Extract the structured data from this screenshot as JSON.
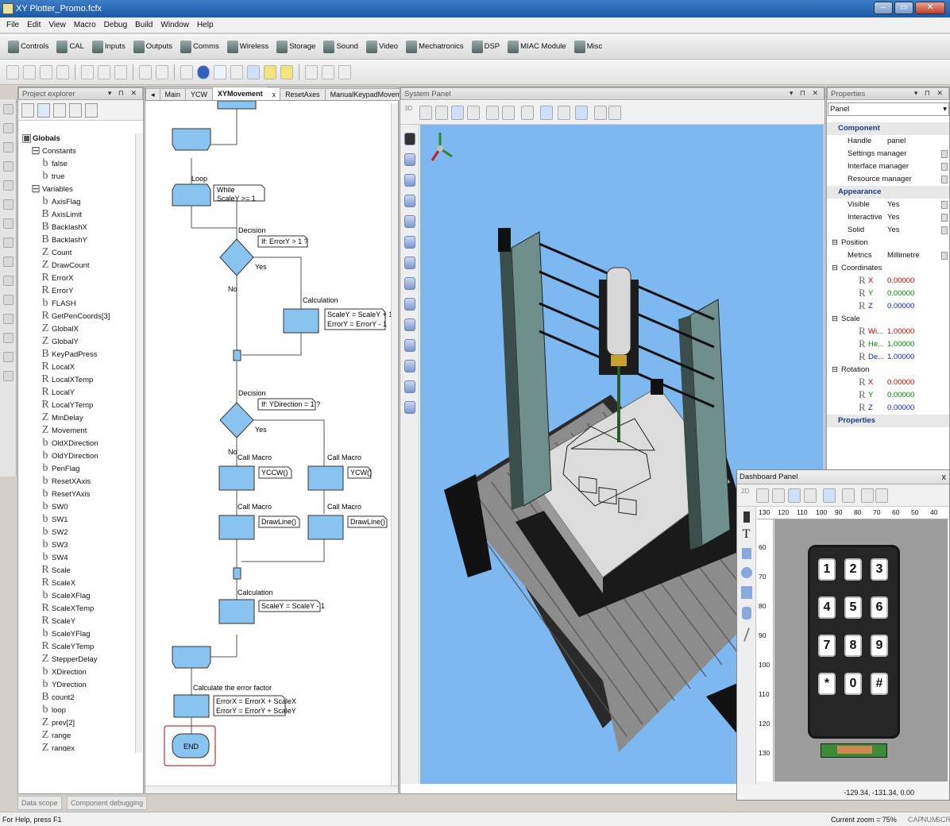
{
  "window": {
    "title": "XY Plotter_Promo.fcfx"
  },
  "menu": [
    "File",
    "Edit",
    "View",
    "Macro",
    "Debug",
    "Build",
    "Window",
    "Help"
  ],
  "component_toolbar": [
    {
      "label": "Controls",
      "icon": "controls-icon"
    },
    {
      "label": "CAL",
      "icon": "chip-icon"
    },
    {
      "label": "Inputs",
      "icon": "inputs-icon"
    },
    {
      "label": "Outputs",
      "icon": "outputs-icon"
    },
    {
      "label": "Comms",
      "icon": "comms-icon"
    },
    {
      "label": "Wireless",
      "icon": "wireless-icon"
    },
    {
      "label": "Storage",
      "icon": "storage-icon"
    },
    {
      "label": "Sound",
      "icon": "speaker-icon"
    },
    {
      "label": "Video",
      "icon": "video-icon"
    },
    {
      "label": "Mechatronics",
      "icon": "mechatronics-icon"
    },
    {
      "label": "DSP",
      "icon": "dsp-icon"
    },
    {
      "label": "MIAC Module",
      "icon": "miac-icon"
    },
    {
      "label": "Misc",
      "icon": "misc-icon"
    }
  ],
  "project_explorer": {
    "title": "Project explorer",
    "root": "Globals",
    "constants_label": "Constants",
    "constants": [
      {
        "t": "b",
        "n": "false"
      },
      {
        "t": "b",
        "n": "true"
      }
    ],
    "variables_label": "Variables",
    "variables": [
      {
        "t": "b",
        "n": "AxisFlag"
      },
      {
        "t": "B",
        "n": "AxisLimit"
      },
      {
        "t": "B",
        "n": "BacklashX"
      },
      {
        "t": "B",
        "n": "BacklashY"
      },
      {
        "t": "Z",
        "n": "Count"
      },
      {
        "t": "Z",
        "n": "DrawCount"
      },
      {
        "t": "R",
        "n": "ErrorX"
      },
      {
        "t": "R",
        "n": "ErrorY"
      },
      {
        "t": "b",
        "n": "FLASH"
      },
      {
        "t": "R",
        "n": "GetPenCoords[3]"
      },
      {
        "t": "Z",
        "n": "GlobalX"
      },
      {
        "t": "Z",
        "n": "GlobalY"
      },
      {
        "t": "B",
        "n": "KeyPadPress"
      },
      {
        "t": "R",
        "n": "LocalX"
      },
      {
        "t": "R",
        "n": "LocalXTemp"
      },
      {
        "t": "R",
        "n": "LocalY"
      },
      {
        "t": "R",
        "n": "LocalYTemp"
      },
      {
        "t": "Z",
        "n": "MinDelay"
      },
      {
        "t": "Z",
        "n": "Movement"
      },
      {
        "t": "b",
        "n": "OldXDirection"
      },
      {
        "t": "b",
        "n": "OldYDirection"
      },
      {
        "t": "b",
        "n": "PenFlag"
      },
      {
        "t": "b",
        "n": "ResetXAxis"
      },
      {
        "t": "b",
        "n": "ResetYAxis"
      },
      {
        "t": "b",
        "n": "SW0"
      },
      {
        "t": "b",
        "n": "SW1"
      },
      {
        "t": "b",
        "n": "SW2"
      },
      {
        "t": "b",
        "n": "SW3"
      },
      {
        "t": "b",
        "n": "SW4"
      },
      {
        "t": "R",
        "n": "Scale"
      },
      {
        "t": "R",
        "n": "ScaleX"
      },
      {
        "t": "b",
        "n": "ScaleXFlag"
      },
      {
        "t": "R",
        "n": "ScaleXTemp"
      },
      {
        "t": "R",
        "n": "ScaleY"
      },
      {
        "t": "b",
        "n": "ScaleYFlag"
      },
      {
        "t": "R",
        "n": "ScaleYTemp"
      },
      {
        "t": "Z",
        "n": "StepperDelay"
      },
      {
        "t": "b",
        "n": "XDirection"
      },
      {
        "t": "b",
        "n": "YDirection"
      },
      {
        "t": "B",
        "n": "count2"
      },
      {
        "t": "b",
        "n": "loop"
      },
      {
        "t": "Z",
        "n": "prev[2]"
      },
      {
        "t": "Z",
        "n": "range"
      },
      {
        "t": "Z",
        "n": "rangex"
      }
    ],
    "bottom_tabs": [
      "Data scope",
      "Component debugging"
    ]
  },
  "flowchart": {
    "tabs": [
      "Main",
      "YCW",
      "XYMovement",
      "ResetAxes",
      "ManualKeypadMovement"
    ],
    "active_tab": "XYMovement",
    "loop_label": "Loop",
    "while_text": [
      "While",
      "ScaleY >= 1"
    ],
    "decision1_label": "Decision",
    "decision1_text": "If: ErrorY > 1 ?",
    "yes": "Yes",
    "no": "No",
    "calc1_label": "Calculation",
    "calc1_text": [
      "ScaleY = ScaleY + 1",
      "ErrorY = ErrorY - 1"
    ],
    "decision2_label": "Decision",
    "decision2_text": "If: YDirection = 1 ?",
    "callmacro_label": "Call Macro",
    "macro_ycc": "YCCW()",
    "macro_ycw": "YCW()",
    "macro_draw": "DrawLine()",
    "calc2_label": "Calculation",
    "calc2_text": "ScaleY = ScaleY - 1",
    "calc3_label": "Calculate the error factor",
    "calc3_text": [
      "ErrorX = ErrorX + ScaleX",
      "ErrorY = ErrorY + ScaleY"
    ],
    "end_label": "END"
  },
  "system_panel": {
    "title": "System Panel",
    "mode": "3D"
  },
  "properties": {
    "title": "Properties",
    "selected": "Panel",
    "rows": [
      {
        "kind": "sec",
        "name": "Component"
      },
      {
        "kind": "row",
        "name": "Handle",
        "value": "panel"
      },
      {
        "kind": "row",
        "name": "Settings manager",
        "value": "",
        "dd": true
      },
      {
        "kind": "row",
        "name": "Interface manager",
        "value": "",
        "dd": true
      },
      {
        "kind": "row",
        "name": "Resource manager",
        "value": "",
        "dd": true
      },
      {
        "kind": "sec",
        "name": "Appearance"
      },
      {
        "kind": "row",
        "name": "Visible",
        "value": "Yes",
        "dd": true
      },
      {
        "kind": "row",
        "name": "Interactive",
        "value": "Yes",
        "dd": true
      },
      {
        "kind": "row",
        "name": "Solid",
        "value": "Yes",
        "dd": true
      },
      {
        "kind": "grp",
        "name": "Position"
      },
      {
        "kind": "row",
        "name": "Metrics",
        "value": "Millimetre",
        "dd": true
      },
      {
        "kind": "grp",
        "name": "Coordinates"
      },
      {
        "kind": "axis",
        "name": "X",
        "value": "0.00000",
        "c": "#c00000"
      },
      {
        "kind": "axis",
        "name": "Y",
        "value": "0.00000",
        "c": "#008000"
      },
      {
        "kind": "axis",
        "name": "Z",
        "value": "0.00000",
        "c": "#1020c0"
      },
      {
        "kind": "grp",
        "name": "Scale"
      },
      {
        "kind": "axis",
        "name": "Wi...",
        "value": "1.00000",
        "c": "#c00000"
      },
      {
        "kind": "axis",
        "name": "He...",
        "value": "1.00000",
        "c": "#008000"
      },
      {
        "kind": "axis",
        "name": "De...",
        "value": "1.00000",
        "c": "#1020c0"
      },
      {
        "kind": "grp",
        "name": "Rotation"
      },
      {
        "kind": "axis",
        "name": "X",
        "value": "0.00000",
        "c": "#c00000"
      },
      {
        "kind": "axis",
        "name": "Y",
        "value": "0.00000",
        "c": "#008000"
      },
      {
        "kind": "axis",
        "name": "Z",
        "value": "0.00000",
        "c": "#1020c0"
      },
      {
        "kind": "sec",
        "name": "Properties"
      }
    ]
  },
  "dashboard": {
    "title": "Dashboard Panel",
    "mode": "2D",
    "ruler_h": [
      "130",
      "120",
      "110",
      "100",
      "90",
      "80",
      "70",
      "60",
      "50",
      "40"
    ],
    "ruler_v": [
      "60",
      "70",
      "80",
      "90",
      "100",
      "110",
      "120",
      "130"
    ],
    "keys": [
      "1",
      "2",
      "3",
      "4",
      "5",
      "6",
      "7",
      "8",
      "9",
      "*",
      "0",
      "#"
    ],
    "coords": "-129.34, -131.34, 0.00"
  },
  "status": {
    "help": "For Help, press F1",
    "zoom": "Current zoom = 75%",
    "indicators": [
      "CAP",
      "NUM",
      "SCRL"
    ]
  }
}
